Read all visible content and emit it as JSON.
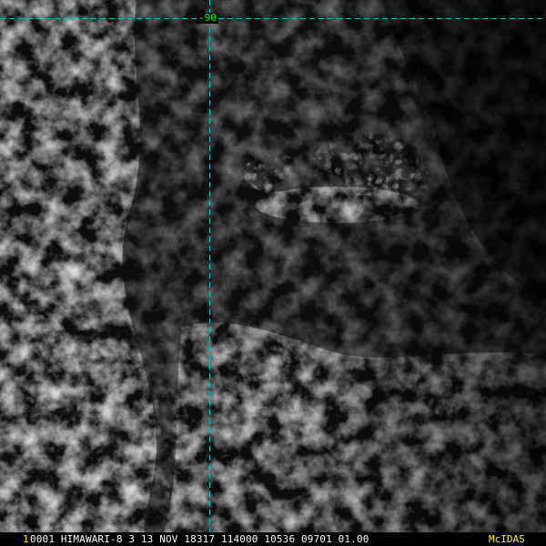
{
  "image": {
    "satellite": "HIMAWARI-8",
    "description_colors": {
      "background": "#0b0b0b",
      "cloud_highlight": "#9a9a9a",
      "grid_line": "#00c8c8"
    }
  },
  "grid": {
    "longitude_label": "-90",
    "line_color": "#00c8c8",
    "label_color": "#00ff00"
  },
  "info_bar": {
    "frame_number": "1",
    "frame_number_color": "#ffff00",
    "text": "0001 HIMAWARI-8   3 13 NOV 18317 114000 10536 09701 01.00",
    "text_color": "#ffffff",
    "logo": "McIDAS",
    "logo_color": "#ffff00"
  }
}
